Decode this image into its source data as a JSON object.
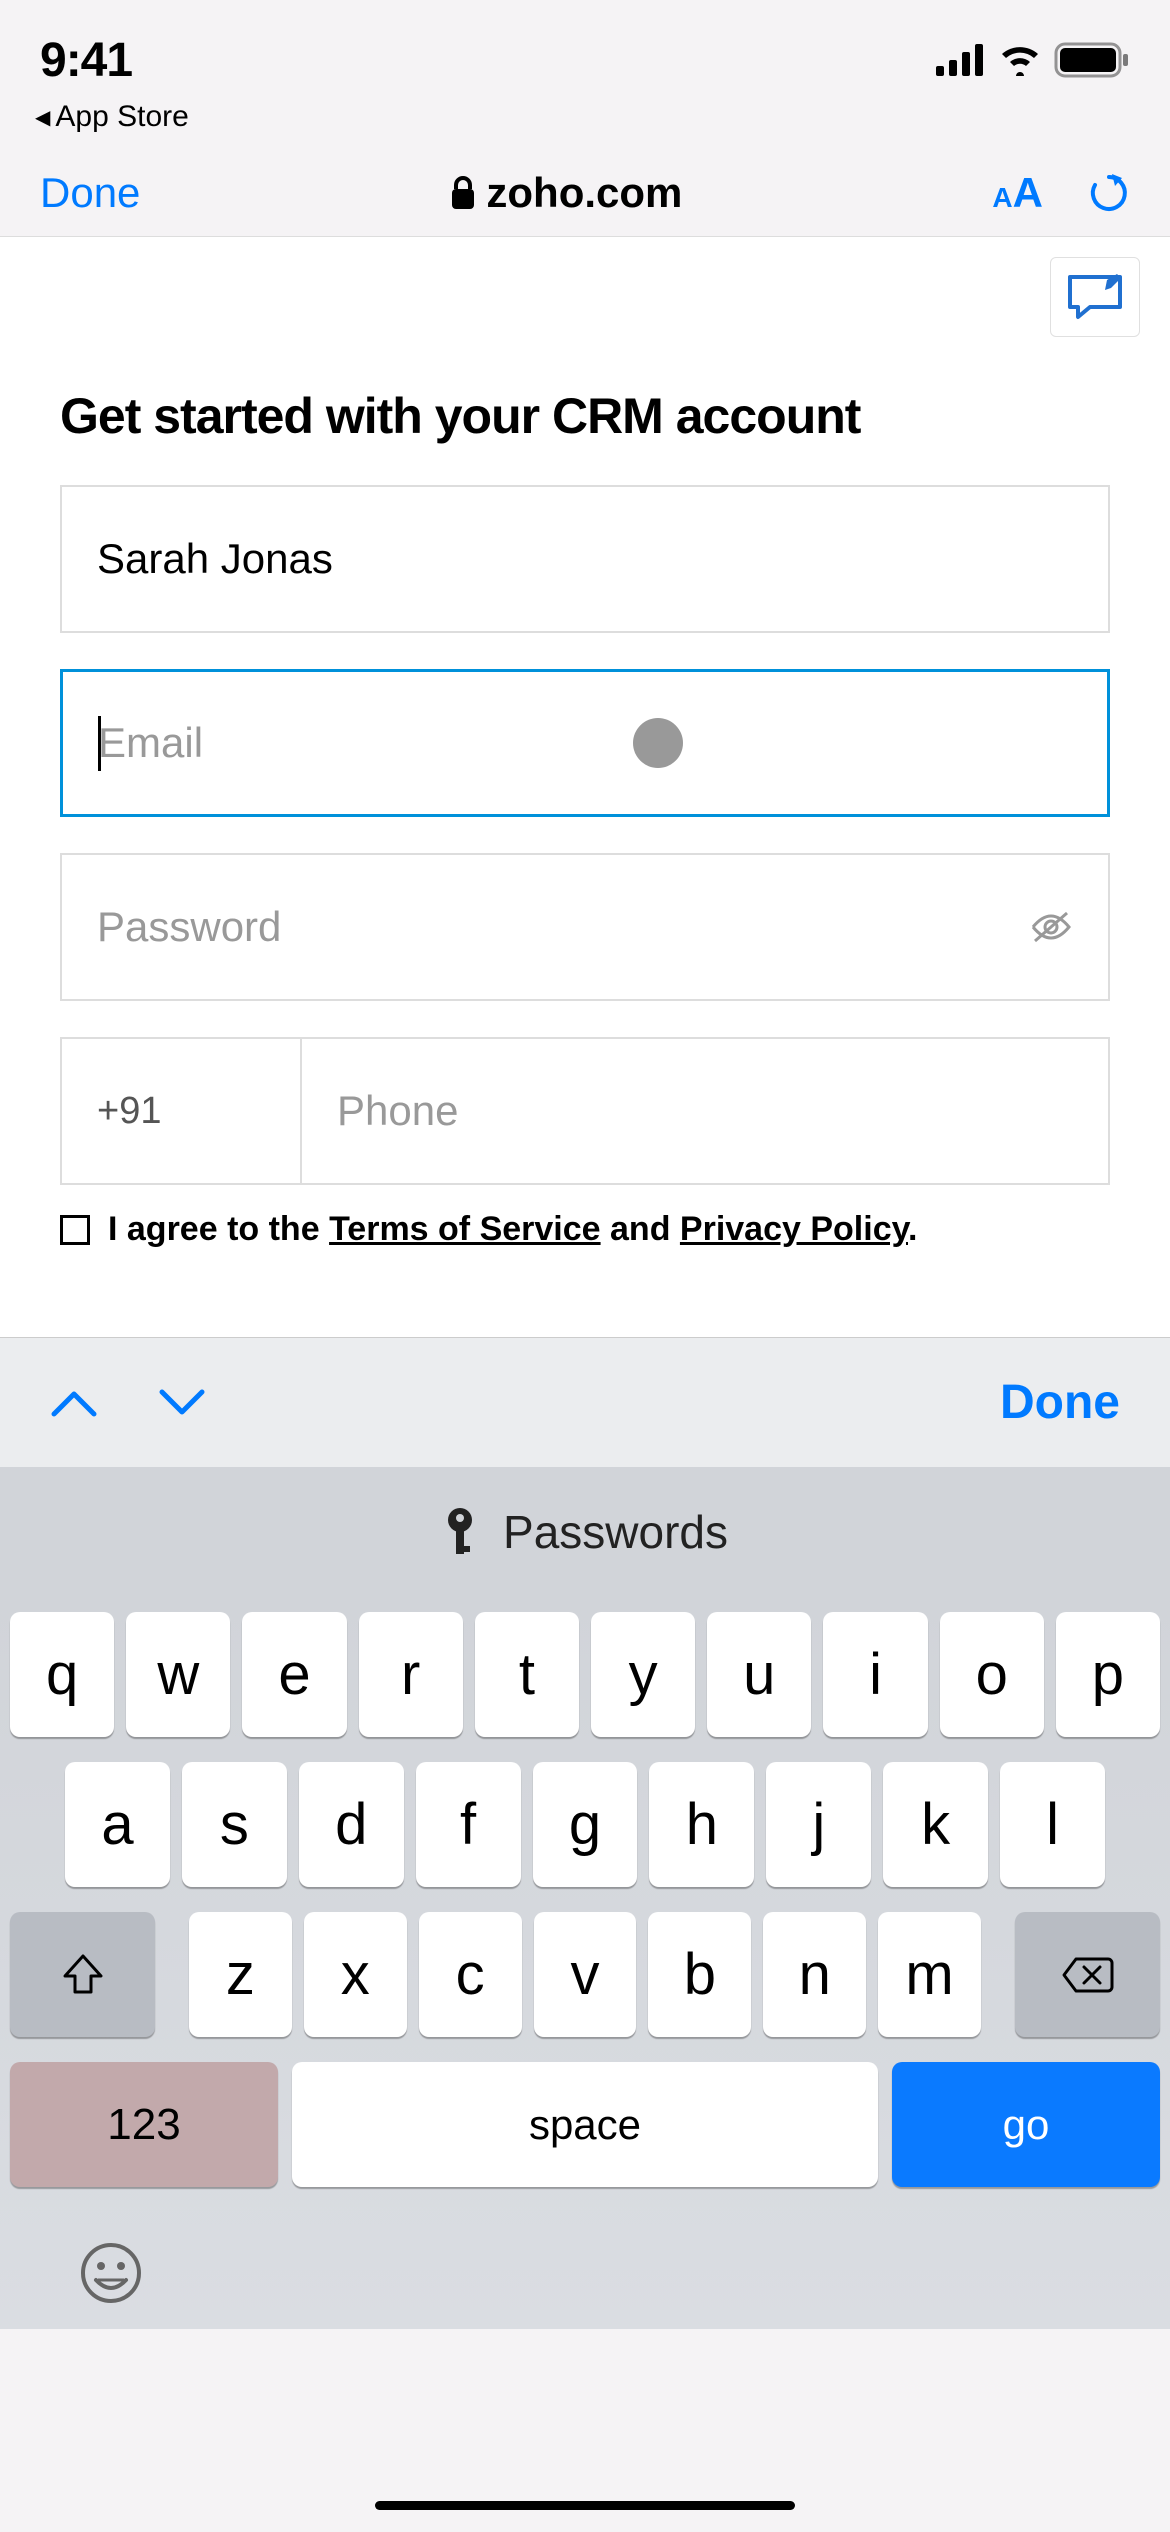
{
  "status": {
    "time": "9:41",
    "back_app": "App Store"
  },
  "nav": {
    "done": "Done",
    "domain": "zoho.com"
  },
  "page": {
    "heading": "Get started with your CRM account",
    "name_value": "Sarah Jonas",
    "email_placeholder": "Email",
    "password_placeholder": "Password",
    "country_code": "+91",
    "phone_placeholder": "Phone",
    "agree_prefix": "I agree to the ",
    "tos": "Terms of Service",
    "agree_mid": " and ",
    "privacy": "Privacy Policy",
    "agree_suffix": "."
  },
  "assist": {
    "done": "Done",
    "passwords": "Passwords"
  },
  "keyboard": {
    "row1": [
      "q",
      "w",
      "e",
      "r",
      "t",
      "y",
      "u",
      "i",
      "o",
      "p"
    ],
    "row2": [
      "a",
      "s",
      "d",
      "f",
      "g",
      "h",
      "j",
      "k",
      "l"
    ],
    "row3": [
      "z",
      "x",
      "c",
      "v",
      "b",
      "n",
      "m"
    ],
    "key_123": "123",
    "key_space": "space",
    "key_go": "go"
  }
}
